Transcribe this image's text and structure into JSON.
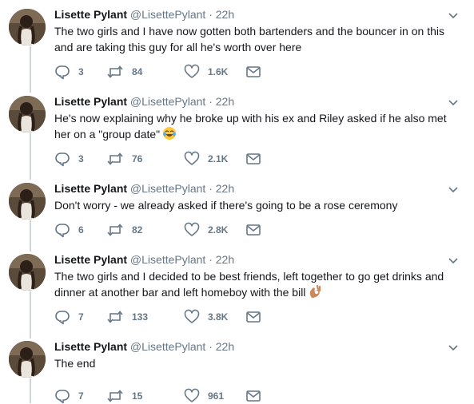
{
  "tweets": [
    {
      "name": "Lisette Pylant",
      "handle": "@LisettePylant",
      "sep": "·",
      "time": "22h",
      "text": "The two girls and I have now gotten both bartenders and the bouncer in on this and are taking this guy for all he's worth over here",
      "replies": "3",
      "retweets": "84",
      "likes": "1.6K"
    },
    {
      "name": "Lisette Pylant",
      "handle": "@LisettePylant",
      "sep": "·",
      "time": "22h",
      "text": "He's now explaining why he broke up with his ex and Riley asked if he also met her on a \"group date\"",
      "emoji": "face-with-tears-of-joy",
      "replies": "3",
      "retweets": "76",
      "likes": "2.1K"
    },
    {
      "name": "Lisette Pylant",
      "handle": "@LisettePylant",
      "sep": "·",
      "time": "22h",
      "text": "Don't worry - we already asked if there's going to be a rose ceremony",
      "replies": "6",
      "retweets": "82",
      "likes": "2.8K"
    },
    {
      "name": "Lisette Pylant",
      "handle": "@LisettePylant",
      "sep": "·",
      "time": "22h",
      "text": "The two girls and I decided to be best friends, left together to go get drinks and dinner at another bar and left homeboy with the bill",
      "emoji": "ok-hand",
      "replies": "7",
      "retweets": "133",
      "likes": "3.8K"
    },
    {
      "name": "Lisette Pylant",
      "handle": "@LisettePylant",
      "sep": "·",
      "time": "22h",
      "text": "The end",
      "replies": "7",
      "retweets": "15",
      "likes": "961"
    }
  ],
  "icons": [
    "reply-icon",
    "retweet-icon",
    "like-icon",
    "direct-message-icon",
    "chevron-down-icon"
  ],
  "colors": {
    "icon": "#657786",
    "thread_line": "#ccd6dd",
    "name": "#14171a",
    "meta": "#657786"
  }
}
